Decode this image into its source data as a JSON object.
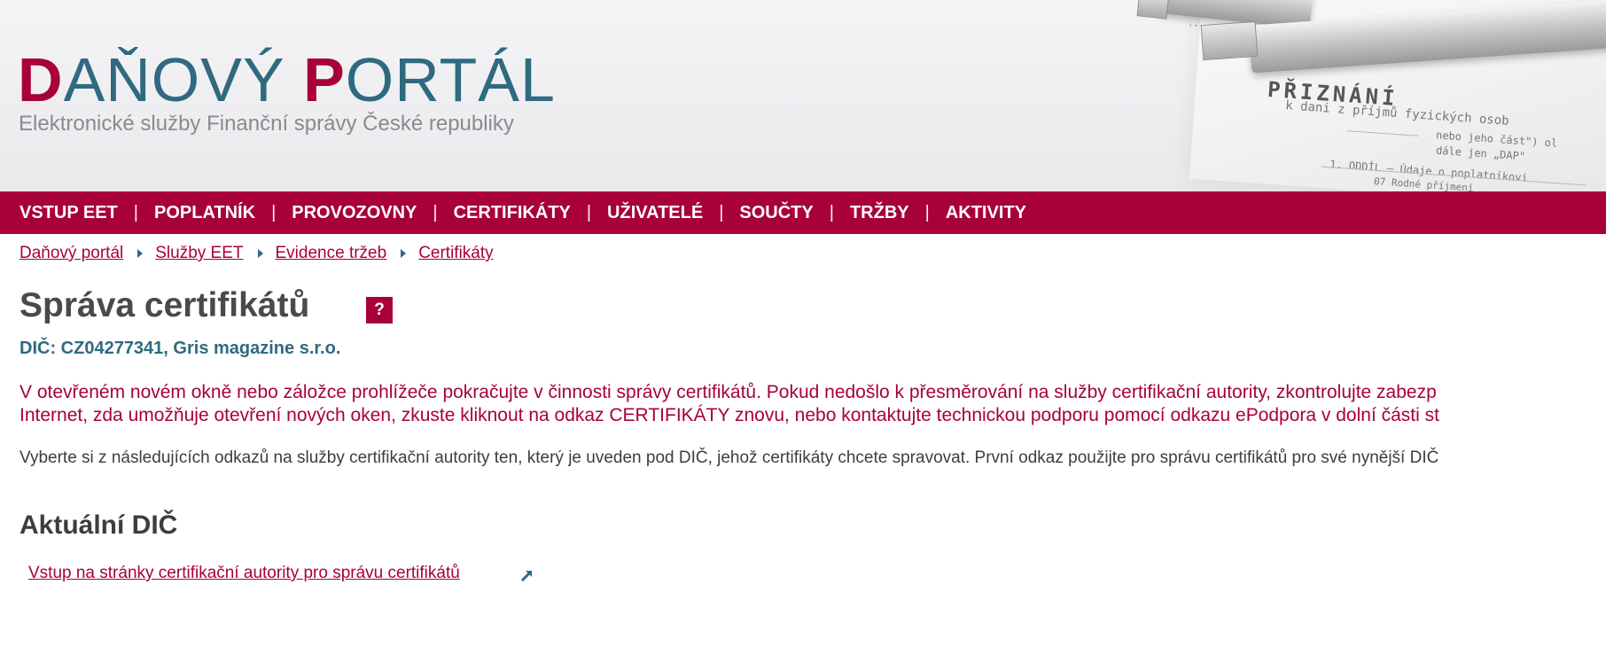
{
  "header": {
    "logo": {
      "cap1": "D",
      "rest1": "AŇOVÝ ",
      "cap2": "P",
      "rest2": "ORTÁL"
    },
    "tagline": "Elektronické služby Finanční správy České republiky",
    "decor": {
      "form_title": "PŘIZNÁNÍ",
      "form_lines": [
        "k dani z příjmů fyzických osob",
        "nebo jeho část\") ol",
        "dále jen „DAP\"",
        "1. ODDÍL – Údaje o poplatníkovi",
        "07 Rodné příjmení"
      ]
    }
  },
  "nav": {
    "items": [
      {
        "label": "VSTUP EET"
      },
      {
        "label": "POPLATNÍK"
      },
      {
        "label": "PROVOZOVNY"
      },
      {
        "label": "CERTIFIKÁTY"
      },
      {
        "label": "UŽIVATELÉ"
      },
      {
        "label": "SOUČTY"
      },
      {
        "label": "TRŽBY"
      },
      {
        "label": "AKTIVITY"
      }
    ],
    "separator": "|"
  },
  "breadcrumb": [
    {
      "label": "Daňový portál"
    },
    {
      "label": "Služby EET"
    },
    {
      "label": "Evidence tržeb"
    },
    {
      "label": "Certifikáty"
    }
  ],
  "page": {
    "title": "Správa certifikátů",
    "help_label": "?",
    "dic_line": "DIČ: CZ04277341, Gris magazine s.r.o.",
    "notice_line1": "V otevřeném novém okně nebo záložce prohlížeče pokračujte v činnosti správy certifikátů. Pokud nedošlo k přesměrování na služby certifikační autority, zkontrolujte zabezp",
    "notice_line2": "Internet, zda umožňuje otevření nových oken, zkuste kliknout na odkaz CERTIFIKÁTY znovu, nebo kontaktujte technickou podporu pomocí odkazu ePodpora v dolní části st",
    "info_line": "Vyberte si z následujících odkazů na služby certifikační autority ten, který je uveden pod DIČ, jehož certifikáty chcete spravovat. První odkaz použijte pro správu certifikátů pro své nynější DIČ",
    "section_title": "Aktuální DIČ",
    "ca_link": "Vstup na stránky certifikační autority pro správu certifikátů"
  },
  "colors": {
    "brand_red": "#a8003a",
    "brand_teal": "#2f6a80",
    "text_dark": "#3d3d3d"
  },
  "icons": {
    "help": "help-icon",
    "breadcrumb_arrow": "chevron-right-icon",
    "external_link": "external-link-icon"
  }
}
